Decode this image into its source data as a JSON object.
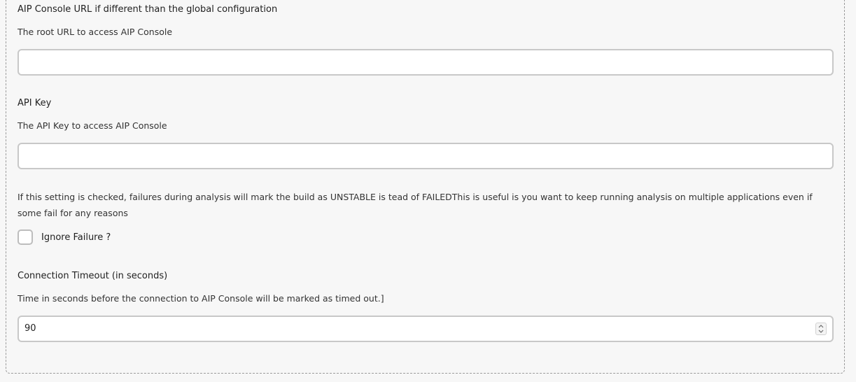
{
  "fields": {
    "console_url": {
      "label": "AIP Console URL if different than the global configuration",
      "description": "The root URL to access AIP Console",
      "value": ""
    },
    "api_key": {
      "label": "API Key",
      "description": "The API Key to access AIP Console",
      "value": ""
    },
    "ignore_failure": {
      "description": "If this setting is checked, failures during analysis will mark the build as UNSTABLE is tead of FAILEDThis is useful is you want to keep running analysis on multiple applications even if some fail for any reasons",
      "label": "Ignore Failure ?",
      "checked": false
    },
    "connection_timeout": {
      "label": "Connection Timeout (in seconds)",
      "description": "Time in seconds before the connection to AIP Console will be marked as timed out.]",
      "value": "90"
    }
  },
  "icons": {
    "spinner_up": "chevron-up-icon",
    "spinner_down": "chevron-down-icon"
  }
}
